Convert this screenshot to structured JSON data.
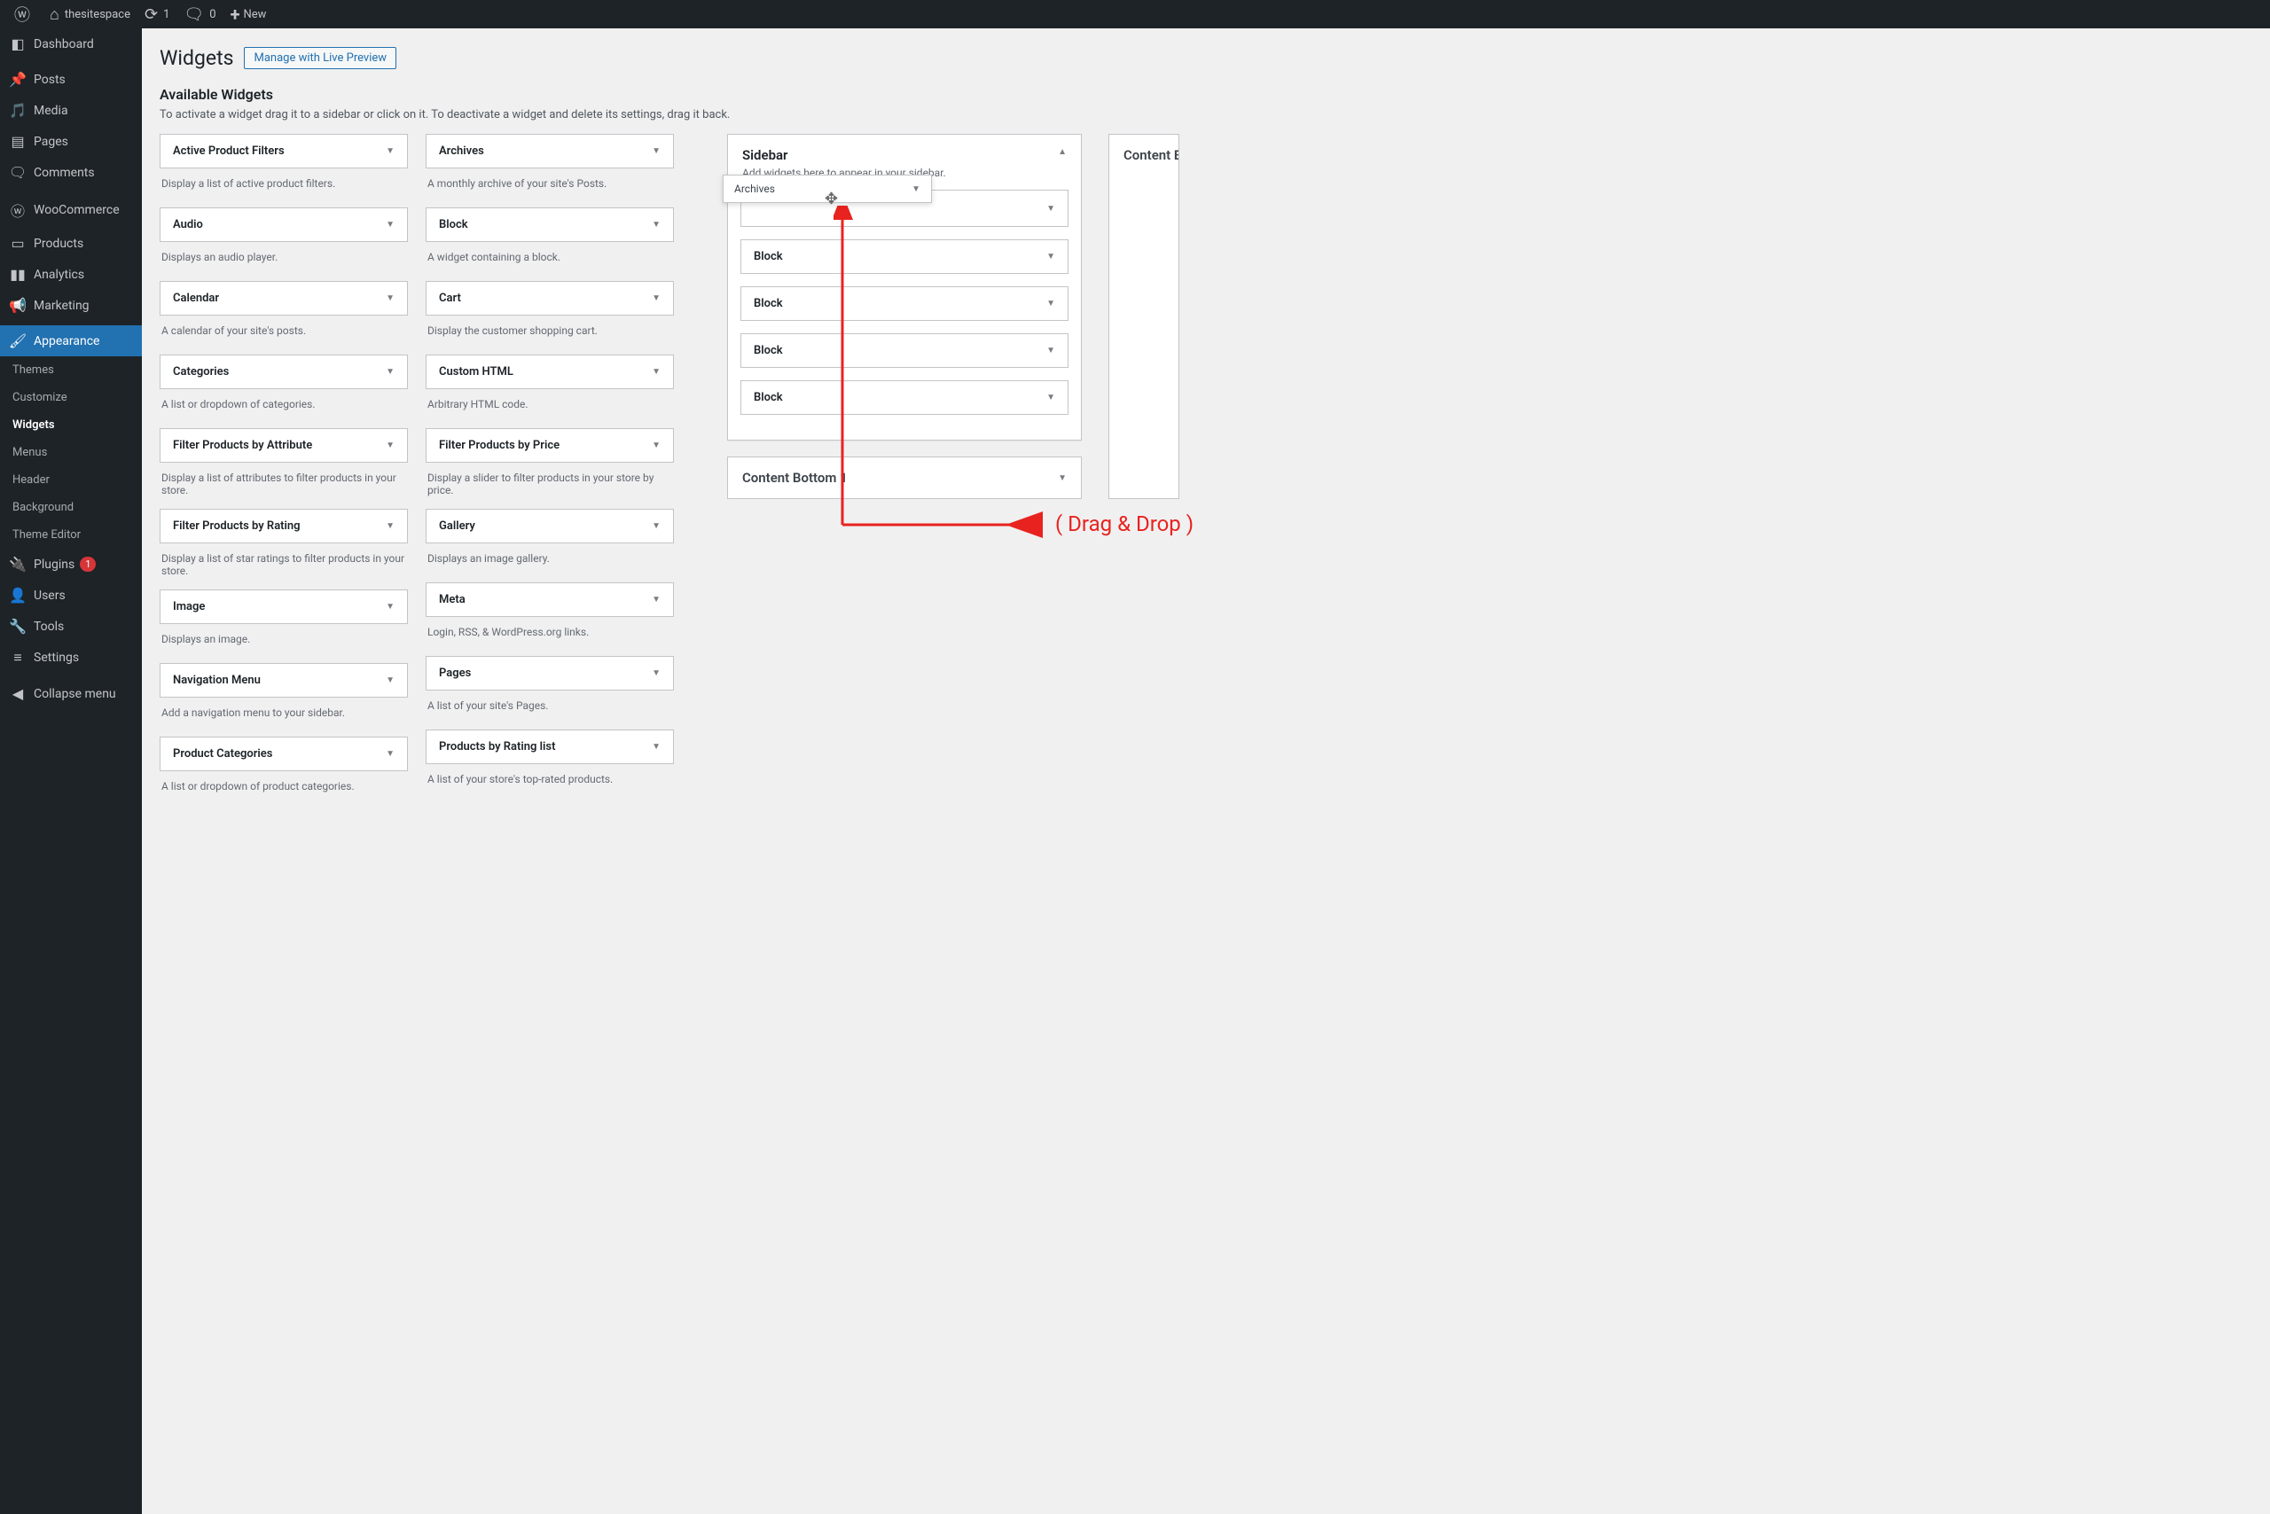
{
  "adminbar": {
    "site_name": "thesitespace",
    "updates_count": "1",
    "comments_count": "0",
    "new_label": "New"
  },
  "menu": {
    "dashboard": "Dashboard",
    "posts": "Posts",
    "media": "Media",
    "pages": "Pages",
    "comments": "Comments",
    "woocommerce": "WooCommerce",
    "products": "Products",
    "analytics": "Analytics",
    "marketing": "Marketing",
    "appearance": "Appearance",
    "plugins": "Plugins",
    "plugins_badge": "1",
    "users": "Users",
    "tools": "Tools",
    "settings": "Settings",
    "collapse": "Collapse menu",
    "appearance_sub": {
      "themes": "Themes",
      "customize": "Customize",
      "widgets": "Widgets",
      "menus": "Menus",
      "header": "Header",
      "background": "Background",
      "theme_editor": "Theme Editor"
    }
  },
  "page": {
    "title": "Widgets",
    "manage_button": "Manage with Live Preview",
    "available_title": "Available Widgets",
    "available_desc": "To activate a widget drag it to a sidebar or click on it. To deactivate a widget and delete its settings, drag it back."
  },
  "widgets_left": [
    {
      "title": "Active Product Filters",
      "desc": "Display a list of active product filters."
    },
    {
      "title": "Audio",
      "desc": "Displays an audio player."
    },
    {
      "title": "Calendar",
      "desc": "A calendar of your site's posts."
    },
    {
      "title": "Categories",
      "desc": "A list or dropdown of categories."
    },
    {
      "title": "Filter Products by Attribute",
      "desc": "Display a list of attributes to filter products in your store."
    },
    {
      "title": "Filter Products by Rating",
      "desc": "Display a list of star ratings to filter products in your store."
    },
    {
      "title": "Image",
      "desc": "Displays an image."
    },
    {
      "title": "Navigation Menu",
      "desc": "Add a navigation menu to your sidebar."
    },
    {
      "title": "Product Categories",
      "desc": "A list or dropdown of product categories."
    }
  ],
  "widgets_right": [
    {
      "title": "Archives",
      "desc": "A monthly archive of your site's Posts."
    },
    {
      "title": "Block",
      "desc": "A widget containing a block."
    },
    {
      "title": "Cart",
      "desc": "Display the customer shopping cart."
    },
    {
      "title": "Custom HTML",
      "desc": "Arbitrary HTML code."
    },
    {
      "title": "Filter Products by Price",
      "desc": "Display a slider to filter products in your store by price."
    },
    {
      "title": "Gallery",
      "desc": "Displays an image gallery."
    },
    {
      "title": "Meta",
      "desc": "Login, RSS, & WordPress.org links."
    },
    {
      "title": "Pages",
      "desc": "A list of your site's Pages."
    },
    {
      "title": "Products by Rating list",
      "desc": "A list of your store's top-rated products."
    }
  ],
  "sidebar_area": {
    "title": "Sidebar",
    "desc": "Add widgets here to appear in your sidebar.",
    "items": [
      "",
      "Block",
      "Block",
      "Block",
      "Block"
    ]
  },
  "content_bottom": {
    "title": "Content Bottom 1"
  },
  "other_area": {
    "title": "Content B"
  },
  "ghost": {
    "title": "Archives"
  },
  "annotation": {
    "label": "( Drag & Drop )"
  }
}
